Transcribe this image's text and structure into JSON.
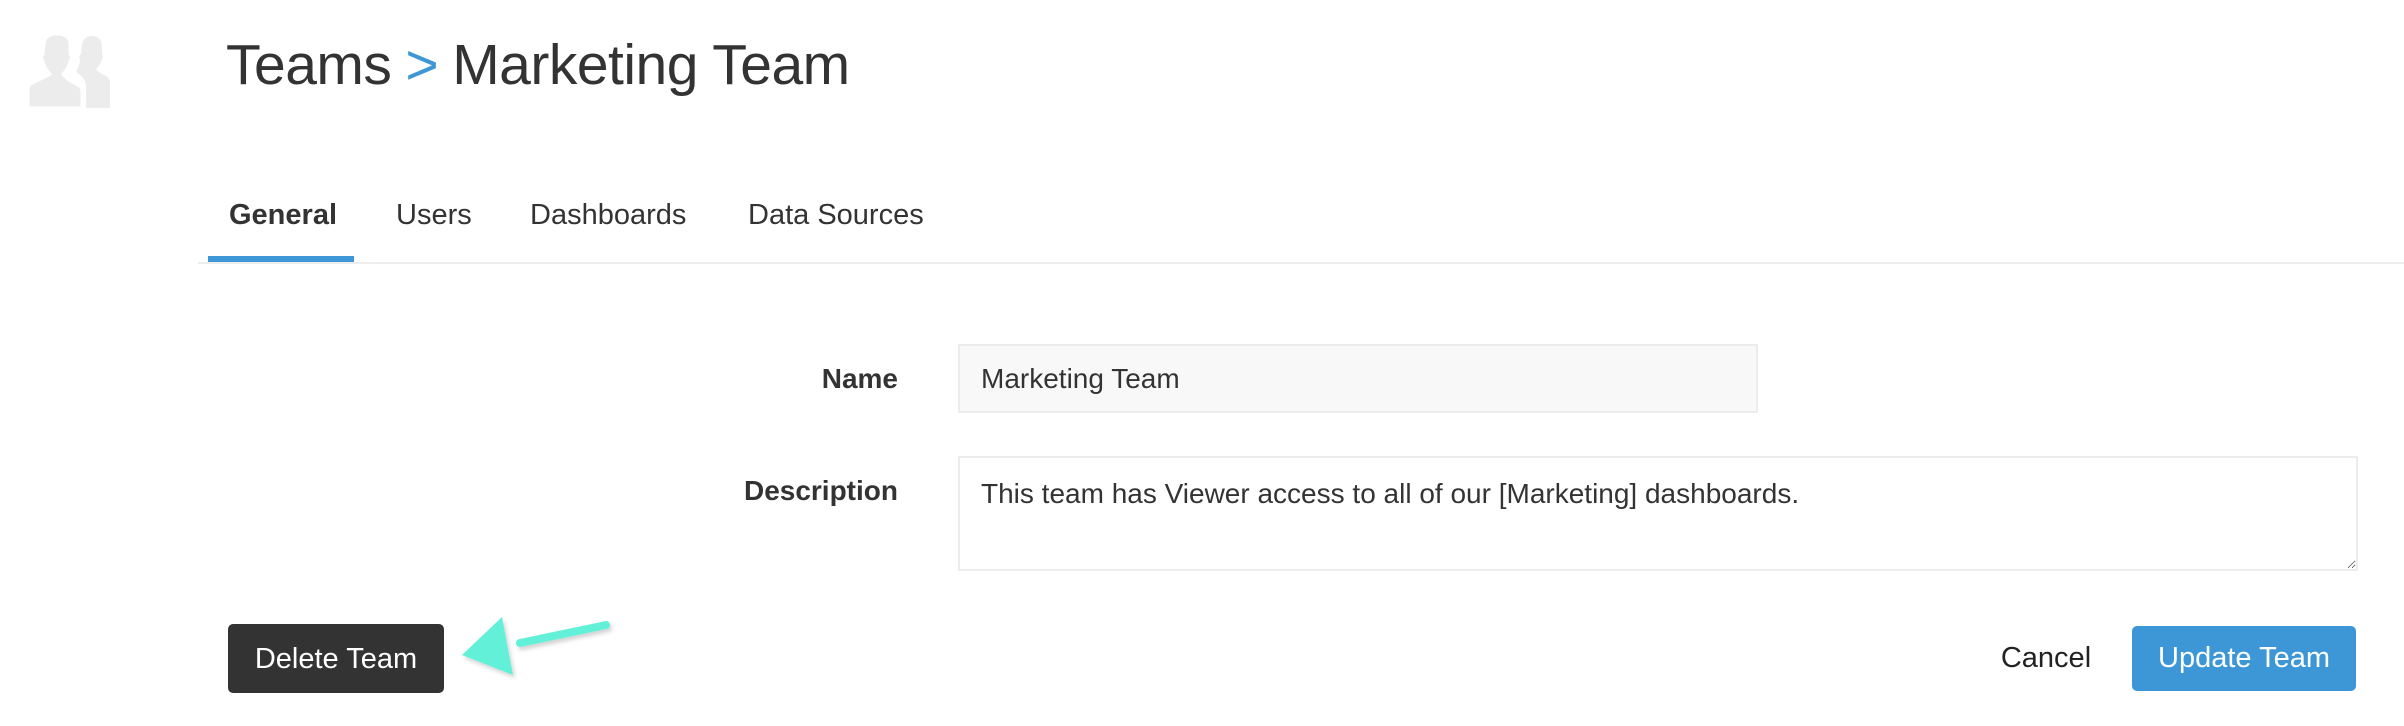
{
  "header": {
    "icon": "team-users-icon",
    "breadcrumb": {
      "parent": "Teams",
      "separator": ">",
      "current": "Marketing Team"
    }
  },
  "tabs": [
    {
      "label": "General",
      "active": true
    },
    {
      "label": "Users",
      "active": false
    },
    {
      "label": "Dashboards",
      "active": false
    },
    {
      "label": "Data Sources",
      "active": false
    }
  ],
  "form": {
    "name": {
      "label": "Name",
      "value": "Marketing Team"
    },
    "description": {
      "label": "Description",
      "value": "This team has Viewer access to all of our [Marketing] dashboards."
    }
  },
  "actions": {
    "delete_label": "Delete Team",
    "cancel_label": "Cancel",
    "update_label": "Update Team"
  },
  "annotation": {
    "type": "arrow",
    "points_to": "Delete Team",
    "color": "#64f0d8"
  },
  "colors": {
    "accent": "#3d97d7",
    "dark_button": "#333333",
    "text": "#333333",
    "input_border": "#ececec",
    "input_bg": "#f8f8f8",
    "icon_gray": "#ececec"
  }
}
